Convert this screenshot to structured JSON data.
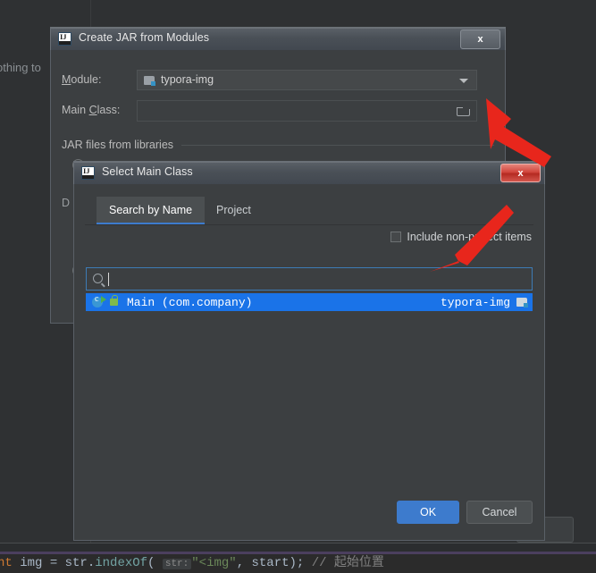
{
  "background": {
    "cut_text": "othing to",
    "code_line": {
      "kw": "nt",
      "seg1": " img = str.",
      "method": "indexOf",
      "paren": "( ",
      "hint": "str:",
      "string": "\"<img\"",
      "seg2": ", start); ",
      "comment": "// 起始位置"
    }
  },
  "jar_dialog": {
    "title": "Create JAR from Modules",
    "close_label": "x",
    "module_label": "Module:",
    "module_label_mnemonic": "M",
    "module_value": "typora-img",
    "module_icon": "module-folder-icon",
    "main_class_label": "Main Class:",
    "main_class_mnemonic": "C",
    "main_class_value": "",
    "browse_icon": "folder-browse-icon",
    "section_label": "JAR files from libraries"
  },
  "select_main_class_dialog": {
    "title": "Select Main Class",
    "close_label": "x",
    "tabs": [
      {
        "label": "Search by Name",
        "active": true
      },
      {
        "label": "Project",
        "active": false
      }
    ],
    "include_non_project": {
      "label": "Include non-project items",
      "checked": false
    },
    "search": {
      "value": "",
      "placeholder": "",
      "icon": "search-icon"
    },
    "results": [
      {
        "class_name": "Main (com.company)",
        "module": "typora-img",
        "class_icon": "runnable-class-icon",
        "visibility_icon": "public-lock-icon",
        "module_icon": "module-folder-icon",
        "selected": true
      }
    ],
    "buttons": {
      "ok": "OK",
      "cancel": "Cancel"
    }
  },
  "annotations": {
    "arrow_color": "#e8261c",
    "arrows": [
      {
        "name": "arrow-to-browse-button"
      },
      {
        "name": "arrow-to-result-row"
      }
    ]
  },
  "colors": {
    "accent_blue": "#3d7bcd",
    "selection_blue": "#1a73e8",
    "dialog_bg": "#3c3f41",
    "ide_bg": "#2f3133",
    "titlebar": "#4a5057",
    "close_red": "#d1453c"
  }
}
